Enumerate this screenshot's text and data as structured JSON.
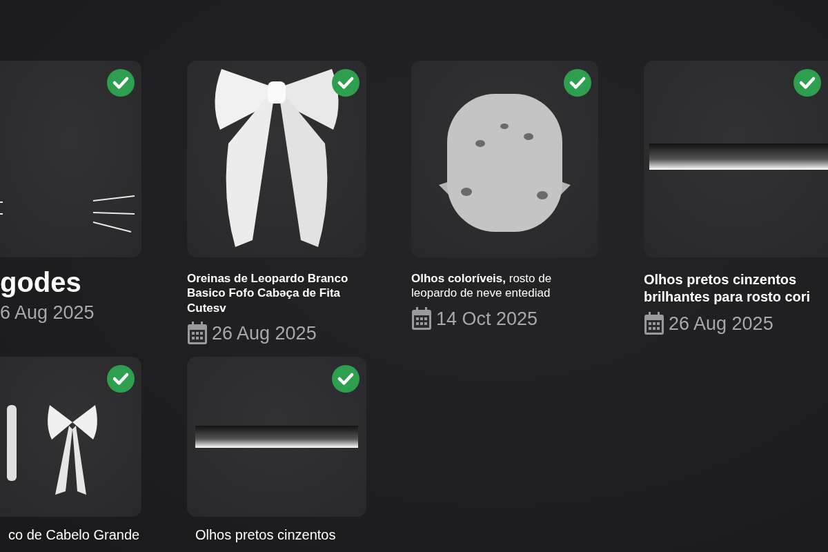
{
  "rows": [
    {
      "items": [
        {
          "kind": "large",
          "title": "godes",
          "date": "6 Aug 2025",
          "owned": true
        },
        {
          "kind": "standard",
          "title": "Oreinas de Leopardo Branco Basico Fofo Cabəça de Fita Cutesv",
          "date": "26 Aug 2025",
          "owned": true
        },
        {
          "kind": "standard",
          "title": "**Olhos coloríveis,** rosto de leopardo de neve entediad",
          "date": "14 Oct 2025",
          "owned": true
        },
        {
          "kind": "wide",
          "title": "Olhos pretos cinzentos brilhantes para rosto cori",
          "date": "26 Aug 2025",
          "owned": true
        }
      ]
    },
    {
      "items": [
        {
          "kind": "plain",
          "title": "co de Cabelo Grande",
          "owned": true
        },
        {
          "kind": "plain",
          "title": "Olhos pretos cinzentos",
          "owned": true
        }
      ]
    }
  ]
}
